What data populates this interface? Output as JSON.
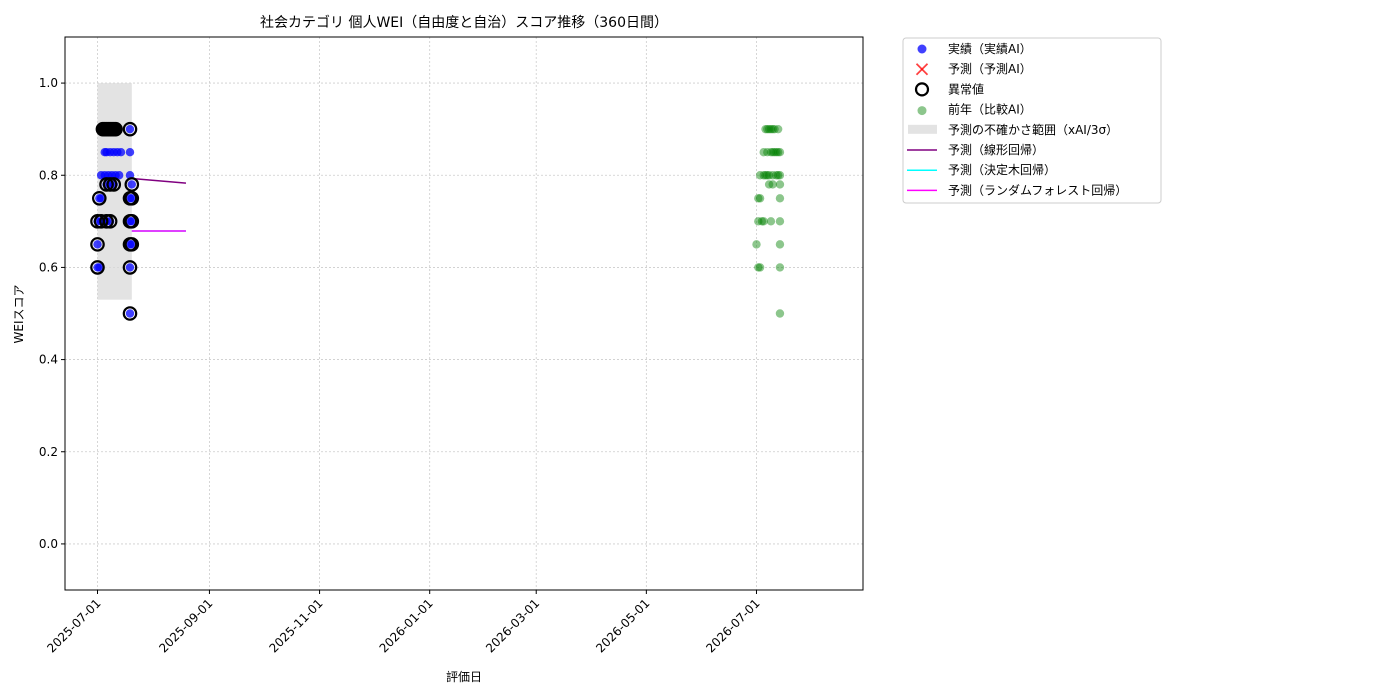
{
  "chart_data": {
    "type": "scatter",
    "title": "社会カテゴリ 個人WEI（自由度と自治）スコア推移（360日間）",
    "xlabel": "評価日",
    "ylabel": "WEIスコア",
    "x_axis_type": "date",
    "xlim": [
      "2025-06-13",
      "2026-08-29"
    ],
    "ylim": [
      -0.1,
      1.1
    ],
    "x_ticks": [
      "2025-07-01",
      "2025-09-01",
      "2025-11-01",
      "2026-01-01",
      "2026-03-01",
      "2026-05-01",
      "2026-07-01"
    ],
    "y_ticks": [
      0.0,
      0.2,
      0.4,
      0.6,
      0.8,
      1.0
    ],
    "y_tick_labels": [
      "0.0",
      "0.2",
      "0.4",
      "0.6",
      "0.8",
      "1.0"
    ],
    "grid": true,
    "legend_position": "outside-right-top",
    "colors": {
      "actual": "#0000ff",
      "predicted": "#ff0000",
      "anomaly_edge": "#000000",
      "previous_year": "#008000",
      "uncertainty": "#d9d9d9",
      "linear": "#800080",
      "tree": "#00ffff",
      "forest": "#ff00ff",
      "grid": "#cccccc"
    },
    "series": [
      {
        "name": "実績（実績AI）",
        "kind": "scatter",
        "points": [
          {
            "x": "2025-07-01",
            "y": 0.6
          },
          {
            "x": "2025-07-01",
            "y": 0.65
          },
          {
            "x": "2025-07-01",
            "y": 0.7
          },
          {
            "x": "2025-07-02",
            "y": 0.6
          },
          {
            "x": "2025-07-02",
            "y": 0.75
          },
          {
            "x": "2025-07-03",
            "y": 0.7
          },
          {
            "x": "2025-07-03",
            "y": 0.75
          },
          {
            "x": "2025-07-03",
            "y": 0.8
          },
          {
            "x": "2025-07-04",
            "y": 0.7
          },
          {
            "x": "2025-07-04",
            "y": 0.9
          },
          {
            "x": "2025-07-05",
            "y": 0.8
          },
          {
            "x": "2025-07-05",
            "y": 0.85
          },
          {
            "x": "2025-07-05",
            "y": 0.9
          },
          {
            "x": "2025-07-06",
            "y": 0.7
          },
          {
            "x": "2025-07-06",
            "y": 0.78
          },
          {
            "x": "2025-07-06",
            "y": 0.85
          },
          {
            "x": "2025-07-06",
            "y": 0.9
          },
          {
            "x": "2025-07-07",
            "y": 0.8
          },
          {
            "x": "2025-07-07",
            "y": 0.9
          },
          {
            "x": "2025-07-08",
            "y": 0.7
          },
          {
            "x": "2025-07-08",
            "y": 0.78
          },
          {
            "x": "2025-07-08",
            "y": 0.85
          },
          {
            "x": "2025-07-08",
            "y": 0.9
          },
          {
            "x": "2025-07-09",
            "y": 0.8
          },
          {
            "x": "2025-07-09",
            "y": 0.9
          },
          {
            "x": "2025-07-10",
            "y": 0.78
          },
          {
            "x": "2025-07-10",
            "y": 0.85
          },
          {
            "x": "2025-07-10",
            "y": 0.9
          },
          {
            "x": "2025-07-11",
            "y": 0.8
          },
          {
            "x": "2025-07-11",
            "y": 0.9
          },
          {
            "x": "2025-07-12",
            "y": 0.85
          },
          {
            "x": "2025-07-13",
            "y": 0.8
          },
          {
            "x": "2025-07-14",
            "y": 0.85
          },
          {
            "x": "2025-07-19",
            "y": 0.5
          },
          {
            "x": "2025-07-19",
            "y": 0.6
          },
          {
            "x": "2025-07-19",
            "y": 0.65
          },
          {
            "x": "2025-07-19",
            "y": 0.7
          },
          {
            "x": "2025-07-19",
            "y": 0.75
          },
          {
            "x": "2025-07-19",
            "y": 0.8
          },
          {
            "x": "2025-07-19",
            "y": 0.85
          },
          {
            "x": "2025-07-19",
            "y": 0.9
          },
          {
            "x": "2025-07-20",
            "y": 0.65
          },
          {
            "x": "2025-07-20",
            "y": 0.7
          },
          {
            "x": "2025-07-20",
            "y": 0.75
          },
          {
            "x": "2025-07-20",
            "y": 0.78
          }
        ]
      },
      {
        "name": "予測（予測AI）",
        "kind": "scatter",
        "points": []
      },
      {
        "name": "異常値",
        "kind": "ring",
        "points": [
          {
            "x": "2025-07-01",
            "y": 0.6
          },
          {
            "x": "2025-07-01",
            "y": 0.65
          },
          {
            "x": "2025-07-01",
            "y": 0.7
          },
          {
            "x": "2025-07-02",
            "y": 0.75
          },
          {
            "x": "2025-07-03",
            "y": 0.7
          },
          {
            "x": "2025-07-04",
            "y": 0.9
          },
          {
            "x": "2025-07-05",
            "y": 0.9
          },
          {
            "x": "2025-07-06",
            "y": 0.7
          },
          {
            "x": "2025-07-06",
            "y": 0.78
          },
          {
            "x": "2025-07-06",
            "y": 0.9
          },
          {
            "x": "2025-07-07",
            "y": 0.9
          },
          {
            "x": "2025-07-08",
            "y": 0.7
          },
          {
            "x": "2025-07-08",
            "y": 0.78
          },
          {
            "x": "2025-07-08",
            "y": 0.9
          },
          {
            "x": "2025-07-09",
            "y": 0.9
          },
          {
            "x": "2025-07-10",
            "y": 0.78
          },
          {
            "x": "2025-07-10",
            "y": 0.9
          },
          {
            "x": "2025-07-11",
            "y": 0.9
          },
          {
            "x": "2025-07-19",
            "y": 0.5
          },
          {
            "x": "2025-07-19",
            "y": 0.6
          },
          {
            "x": "2025-07-19",
            "y": 0.65
          },
          {
            "x": "2025-07-19",
            "y": 0.7
          },
          {
            "x": "2025-07-19",
            "y": 0.75
          },
          {
            "x": "2025-07-19",
            "y": 0.9
          },
          {
            "x": "2025-07-20",
            "y": 0.65
          },
          {
            "x": "2025-07-20",
            "y": 0.7
          },
          {
            "x": "2025-07-20",
            "y": 0.75
          },
          {
            "x": "2025-07-20",
            "y": 0.78
          }
        ]
      },
      {
        "name": "前年（比較AI）",
        "kind": "scatter",
        "points": [
          {
            "x": "2026-07-01",
            "y": 0.65
          },
          {
            "x": "2026-07-02",
            "y": 0.6
          },
          {
            "x": "2026-07-03",
            "y": 0.6
          },
          {
            "x": "2026-07-02",
            "y": 0.7
          },
          {
            "x": "2026-07-02",
            "y": 0.75
          },
          {
            "x": "2026-07-03",
            "y": 0.75
          },
          {
            "x": "2026-07-03",
            "y": 0.8
          },
          {
            "x": "2026-07-04",
            "y": 0.7
          },
          {
            "x": "2026-07-05",
            "y": 0.7
          },
          {
            "x": "2026-07-05",
            "y": 0.8
          },
          {
            "x": "2026-07-05",
            "y": 0.85
          },
          {
            "x": "2026-07-06",
            "y": 0.8
          },
          {
            "x": "2026-07-06",
            "y": 0.9
          },
          {
            "x": "2026-07-07",
            "y": 0.8
          },
          {
            "x": "2026-07-07",
            "y": 0.85
          },
          {
            "x": "2026-07-07",
            "y": 0.9
          },
          {
            "x": "2026-07-08",
            "y": 0.78
          },
          {
            "x": "2026-07-08",
            "y": 0.8
          },
          {
            "x": "2026-07-08",
            "y": 0.9
          },
          {
            "x": "2026-07-09",
            "y": 0.7
          },
          {
            "x": "2026-07-09",
            "y": 0.85
          },
          {
            "x": "2026-07-09",
            "y": 0.9
          },
          {
            "x": "2026-07-10",
            "y": 0.78
          },
          {
            "x": "2026-07-10",
            "y": 0.8
          },
          {
            "x": "2026-07-10",
            "y": 0.85
          },
          {
            "x": "2026-07-10",
            "y": 0.9
          },
          {
            "x": "2026-07-11",
            "y": 0.85
          },
          {
            "x": "2026-07-11",
            "y": 0.9
          },
          {
            "x": "2026-07-12",
            "y": 0.8
          },
          {
            "x": "2026-07-12",
            "y": 0.85
          },
          {
            "x": "2026-07-13",
            "y": 0.8
          },
          {
            "x": "2026-07-13",
            "y": 0.85
          },
          {
            "x": "2026-07-13",
            "y": 0.9
          },
          {
            "x": "2026-07-14",
            "y": 0.5
          },
          {
            "x": "2026-07-14",
            "y": 0.6
          },
          {
            "x": "2026-07-14",
            "y": 0.65
          },
          {
            "x": "2026-07-14",
            "y": 0.7
          },
          {
            "x": "2026-07-14",
            "y": 0.75
          },
          {
            "x": "2026-07-14",
            "y": 0.78
          },
          {
            "x": "2026-07-14",
            "y": 0.8
          },
          {
            "x": "2026-07-14",
            "y": 0.85
          }
        ]
      },
      {
        "name": "予測の不確かさ範囲（xAI/3σ）",
        "kind": "band",
        "x_range": [
          "2025-07-01",
          "2025-07-20"
        ],
        "y_range": [
          0.53,
          1.0
        ]
      },
      {
        "name": "予測（線形回帰）",
        "kind": "line",
        "points": [
          {
            "x": "2025-07-20",
            "y": 0.793
          },
          {
            "x": "2025-08-19",
            "y": 0.783
          }
        ]
      },
      {
        "name": "予測（決定木回帰）",
        "kind": "line",
        "points": [
          {
            "x": "2025-07-20",
            "y": 0.679
          },
          {
            "x": "2025-08-19",
            "y": 0.679
          }
        ]
      },
      {
        "name": "予測（ランダムフォレスト回帰）",
        "kind": "line",
        "points": [
          {
            "x": "2025-07-20",
            "y": 0.679
          },
          {
            "x": "2025-08-19",
            "y": 0.679
          }
        ]
      }
    ]
  }
}
